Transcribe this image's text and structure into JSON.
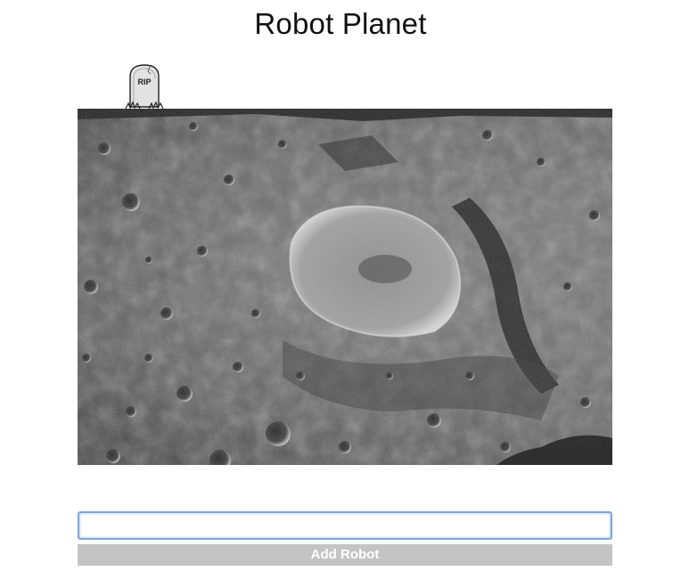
{
  "header": {
    "title": "Robot Planet"
  },
  "grave": {
    "icon": "tombstone-icon",
    "inscription": "RIP"
  },
  "planet": {
    "image": "cratered-moon-surface",
    "colors": {
      "surface": "#6e6e6e",
      "shadow": "#1e1e1e",
      "highlight": "#bdbdbd"
    }
  },
  "form": {
    "input_value": "",
    "input_placeholder": "",
    "input_focus_color": "#7fa6d8",
    "button_label": "Add Robot",
    "button_color": "#c4c4c4"
  }
}
